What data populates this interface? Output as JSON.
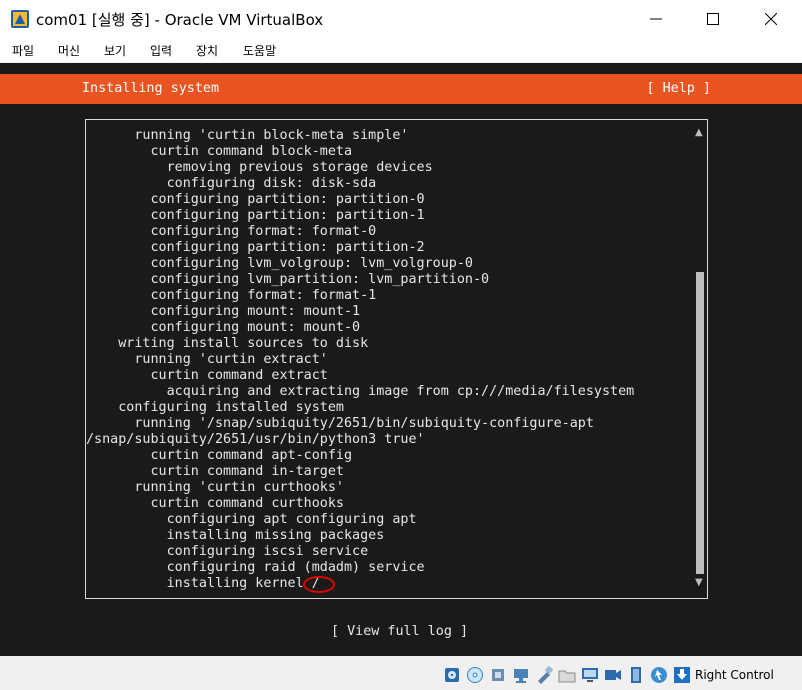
{
  "window": {
    "title": "com01 [실행 중] - Oracle VM VirtualBox"
  },
  "menu": {
    "items": [
      "파일",
      "머신",
      "보기",
      "입력",
      "장치",
      "도움말"
    ]
  },
  "installer": {
    "header_title": "Installing system",
    "help_label": "[ Help ]",
    "log_lines": [
      "      running 'curtin block-meta simple'",
      "        curtin command block-meta",
      "          removing previous storage devices",
      "          configuring disk: disk-sda",
      "        configuring partition: partition-0",
      "        configuring partition: partition-1",
      "        configuring format: format-0",
      "        configuring partition: partition-2",
      "        configuring lvm_volgroup: lvm_volgroup-0",
      "        configuring lvm_partition: lvm_partition-0",
      "        configuring format: format-1",
      "        configuring mount: mount-1",
      "        configuring mount: mount-0",
      "    writing install sources to disk",
      "      running 'curtin extract'",
      "        curtin command extract",
      "          acquiring and extracting image from cp:///media/filesystem",
      "    configuring installed system",
      "      running '/snap/subiquity/2651/bin/subiquity-configure-apt",
      "/snap/subiquity/2651/usr/bin/python3 true'",
      "        curtin command apt-config",
      "        curtin command in-target",
      "      running 'curtin curthooks'",
      "        curtin command curthooks",
      "          configuring apt configuring apt",
      "          installing missing packages",
      "          configuring iscsi service",
      "          configuring raid (mdadm) service",
      "          installing kernel /"
    ],
    "scroll_up_glyph": "▲",
    "scroll_down_glyph": "▼",
    "view_log_label": "[ View full log ]"
  },
  "statusbar": {
    "host_key_label": "Right Control",
    "icons": [
      "hard-disk-icon",
      "optical-drive-icon",
      "audio-icon",
      "network-icon",
      "usb-icon",
      "shared-folders-icon",
      "display-icon",
      "recording-icon",
      "cpu-icon",
      "mouse-integration-icon",
      "keyboard-icon"
    ]
  },
  "colors": {
    "header_accent": "#e95420",
    "terminal_bg": "#1a1a1a",
    "terminal_text": "#e6e6e6",
    "annotation_circle": "#e00000"
  }
}
